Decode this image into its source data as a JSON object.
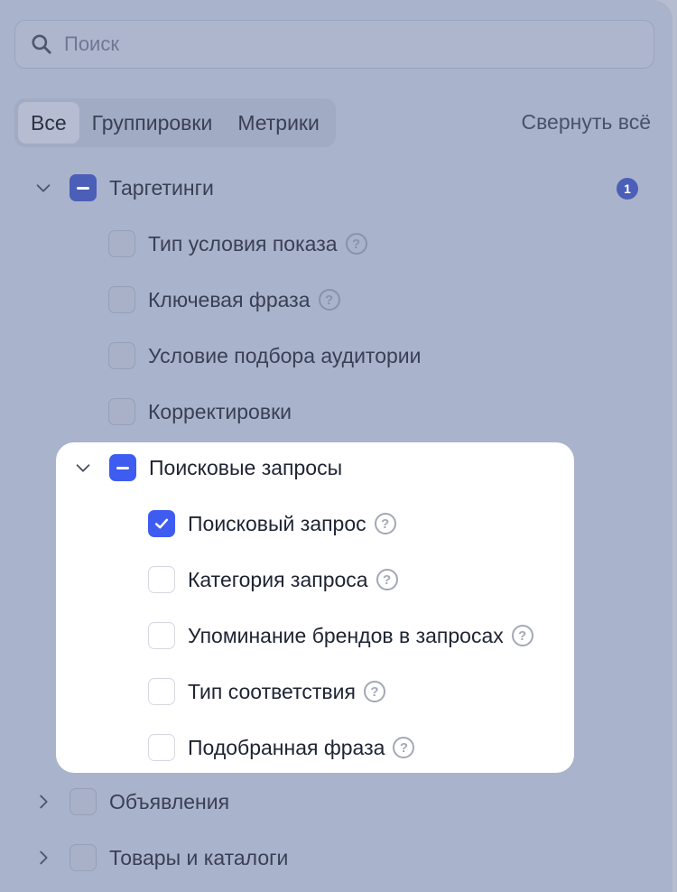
{
  "search": {
    "placeholder": "Поиск"
  },
  "tabs": [
    {
      "label": "Все",
      "active": true
    },
    {
      "label": "Группировки",
      "active": false
    },
    {
      "label": "Метрики",
      "active": false
    }
  ],
  "collapse_all": "Свернуть всё",
  "groups": {
    "targeting": {
      "label": "Таргетинги",
      "badge": "1",
      "items": [
        {
          "label": "Тип условия показа",
          "help": "?"
        },
        {
          "label": "Ключевая фраза",
          "help": "?"
        },
        {
          "label": "Условие подбора аудитории"
        },
        {
          "label": "Корректировки"
        }
      ]
    },
    "search_queries": {
      "label": "Поисковые запросы",
      "items": [
        {
          "label": "Поисковый запрос",
          "checked": true,
          "help": "?"
        },
        {
          "label": "Категория запроса",
          "checked": false,
          "help": "?"
        },
        {
          "label": "Упоминание брендов в запросах",
          "checked": false,
          "help": "?"
        },
        {
          "label": "Тип соответствия",
          "checked": false,
          "help": "?"
        },
        {
          "label": "Подобранная фраза",
          "checked": false,
          "help": "?"
        }
      ]
    },
    "ads": {
      "label": "Объявления"
    },
    "products": {
      "label": "Товары и каталоги"
    }
  },
  "colors": {
    "accent": "#3e5cf0",
    "accent_dim": "#4b5fb8",
    "overlay": "#aab3cc"
  }
}
